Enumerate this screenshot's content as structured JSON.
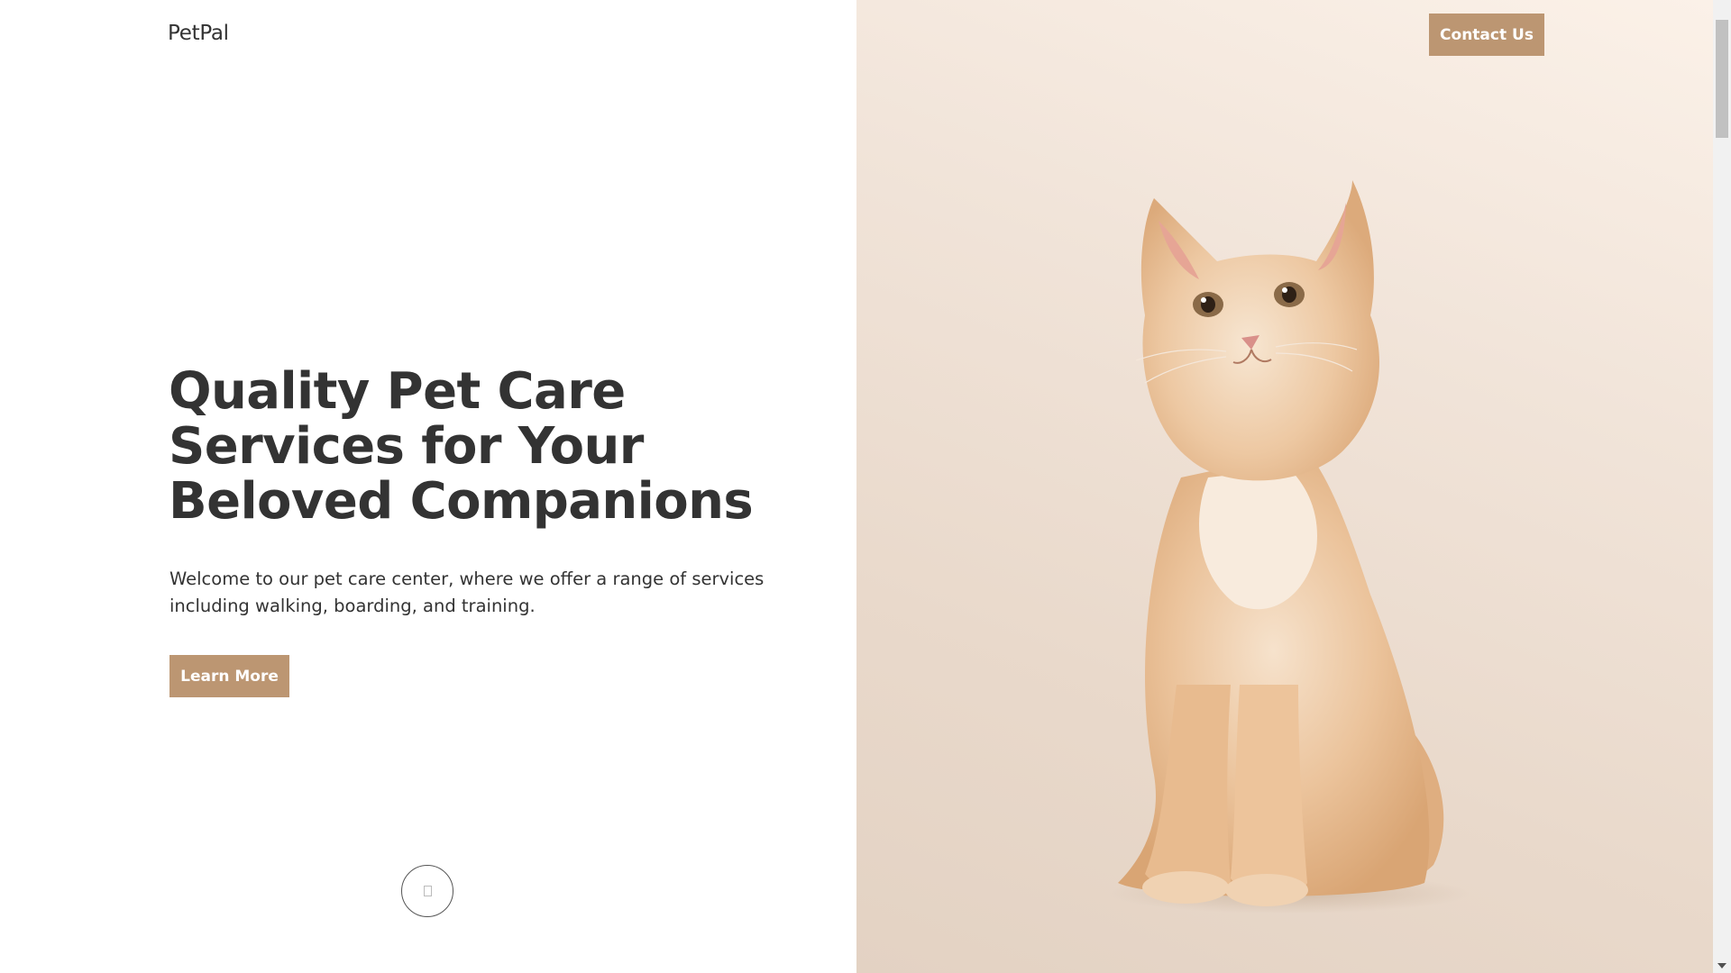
{
  "brand": {
    "name": "PetPal"
  },
  "header": {
    "contact_label": "Contact Us"
  },
  "hero": {
    "title": "Quality Pet Care Services for Your Beloved Companions",
    "description": "Welcome to our pet care center, where we offer a range of services including walking, boarding, and training.",
    "cta_label": "Learn More"
  },
  "scroll_indicator": {
    "icon": "scroll-down-icon"
  },
  "hero_image": {
    "subject": "kitten-photo"
  },
  "colors": {
    "accent": "#bc9672",
    "text": "#333333",
    "image_background": "#f1e4d9"
  }
}
